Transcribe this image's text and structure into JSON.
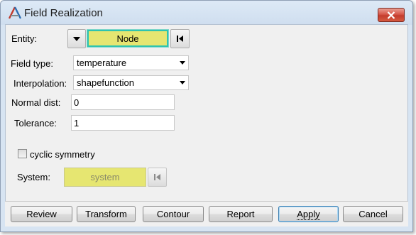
{
  "window": {
    "title": "Field Realization"
  },
  "entity": {
    "label": "Entity:",
    "value": "Node"
  },
  "field_type": {
    "label": "Field type:",
    "value": "temperature"
  },
  "interpolation": {
    "label": "Interpolation:",
    "value": "shapefunction"
  },
  "normal_dist": {
    "label": "Normal dist:",
    "value": "0"
  },
  "tolerance": {
    "label": "Tolerance:",
    "value": "1"
  },
  "cyclic": {
    "label": "cyclic symmetry",
    "checked": false
  },
  "system": {
    "label": "System:",
    "value": "system"
  },
  "buttons": {
    "review": "Review",
    "transform": "Transform",
    "contour": "Contour",
    "report": "Report",
    "apply": "Apply",
    "cancel": "Cancel"
  },
  "colors": {
    "selector_fill": "#e6e671",
    "selector_active_border": "#2fc4b0",
    "close_button": "#d7584a",
    "panel_bg": "#f0f0f0"
  },
  "icons": [
    "app-logo-icon",
    "close-icon",
    "dropdown-arrow-icon",
    "reset-selection-icon"
  ]
}
